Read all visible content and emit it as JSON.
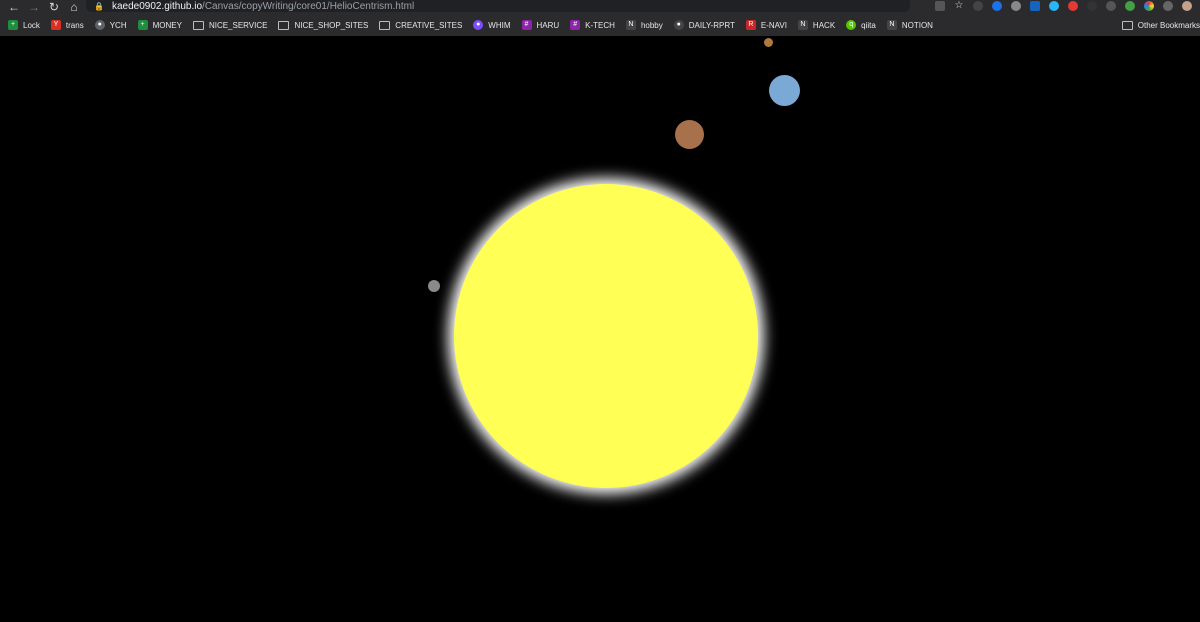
{
  "browser": {
    "url_host": "kaede0902.github.io",
    "url_path": "/Canvas/copyWriting/core01/HelioCentrism.html",
    "nav_back_icon": "arrow-left-icon",
    "nav_forward_icon": "arrow-right-icon",
    "reload_icon": "reload-icon",
    "home_icon": "home-icon"
  },
  "bookmarks": [
    {
      "label": "Lock",
      "icon": "sheet-icon",
      "color": "#1e8e3e"
    },
    {
      "label": "trans",
      "icon": "translate-icon",
      "color": "#d93025"
    },
    {
      "label": "YCH",
      "icon": "globe-icon",
      "color": "#5f6368"
    },
    {
      "label": "MONEY",
      "icon": "sheet-icon",
      "color": "#1e8e3e"
    },
    {
      "label": "NICE_SERVICE",
      "icon": "folder-icon",
      "color": "#5f6368"
    },
    {
      "label": "NICE_SHOP_SITES",
      "icon": "folder-icon",
      "color": "#5f6368"
    },
    {
      "label": "CREATIVE_SITES",
      "icon": "folder-icon",
      "color": "#5f6368"
    },
    {
      "label": "WHIM",
      "icon": "circle-icon",
      "color": "#7c4dff"
    },
    {
      "label": "HARU",
      "icon": "slack-icon",
      "color": "#8e24aa"
    },
    {
      "label": "K-TECH",
      "icon": "slack-icon",
      "color": "#8e24aa"
    },
    {
      "label": "hobby",
      "icon": "notion-icon",
      "color": "#444444"
    },
    {
      "label": "DAILY-RPRT",
      "icon": "github-icon",
      "color": "#444444"
    },
    {
      "label": "E-NAVI",
      "icon": "r-icon",
      "color": "#c62828"
    },
    {
      "label": "HACK",
      "icon": "notion-icon",
      "color": "#444444"
    },
    {
      "label": "qiita",
      "icon": "qiita-icon",
      "color": "#55c500"
    },
    {
      "label": "NOTION",
      "icon": "notion-icon",
      "color": "#444444"
    }
  ],
  "other_bookmarks": {
    "label": "Other Bookmarks",
    "icon": "folder-icon"
  },
  "scene": {
    "sun": {
      "color": "#ffff55",
      "glow": "#ffffff"
    },
    "planets": [
      {
        "name": "mercury",
        "color": "#8a8a8a"
      },
      {
        "name": "venus",
        "color": "#b07a3c"
      },
      {
        "name": "earth",
        "color": "#7aa9d6"
      },
      {
        "name": "mars",
        "color": "#a7714b"
      }
    ]
  }
}
